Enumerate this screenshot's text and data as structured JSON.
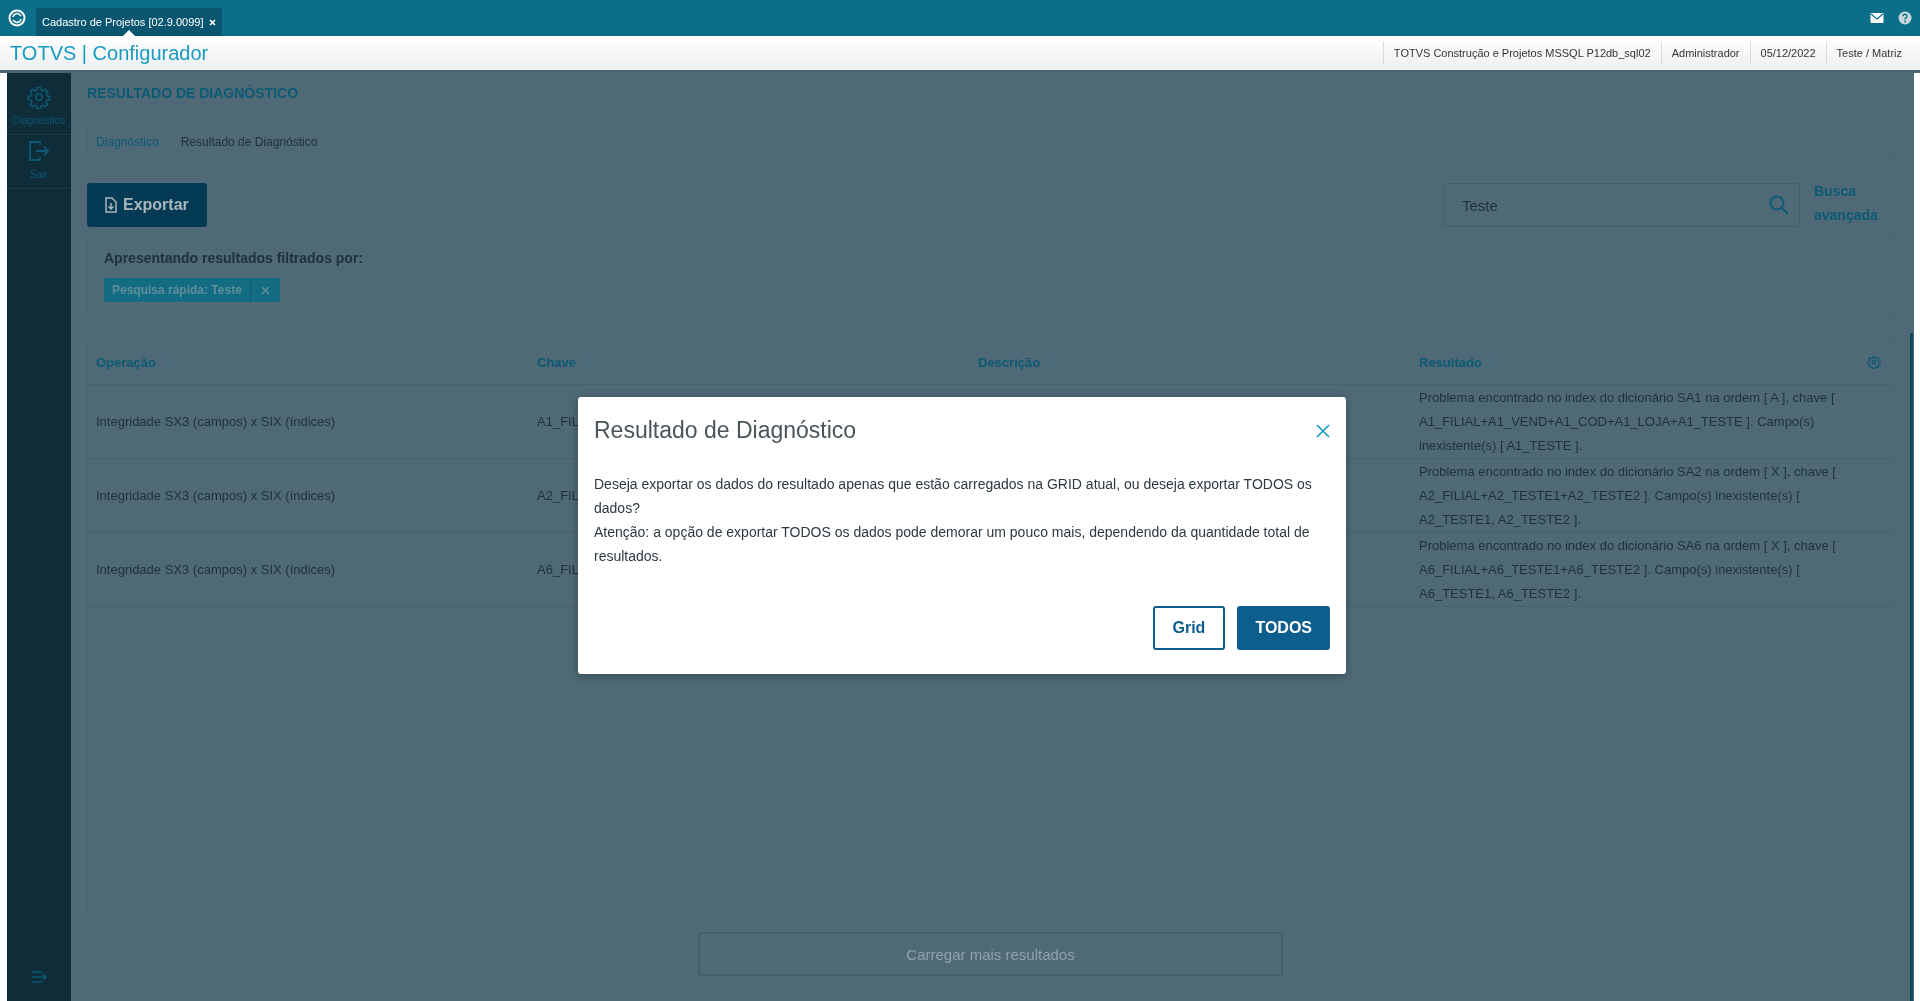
{
  "tab_bar": {
    "tabs": [
      {
        "label": "Cadastro de Projetos [02.9.0099]",
        "selected": true
      }
    ]
  },
  "header": {
    "title": "TOTVS | Configurador",
    "info": [
      "TOTVS Construção e Projetos MSSQL P12db_sql02",
      "Administrador",
      "05/12/2022",
      "Teste / Matriz"
    ]
  },
  "sidebar": {
    "items": [
      {
        "label": "Diagnóstico",
        "kind": "settings"
      },
      {
        "label": "Sair",
        "kind": "exit"
      }
    ]
  },
  "page": {
    "title": "RESULTADO DE DIAGNÓSTICO",
    "breadcrumb": [
      "Diagnóstico",
      "Resultado de Diagnóstico"
    ],
    "export_button": "Exportar",
    "search": {
      "value": "Teste"
    },
    "advanced_search": "Busca avançada",
    "filter": {
      "label": "Apresentando resultados filtrados por:",
      "tags": [
        "Pesquisa rápida: Teste"
      ]
    },
    "table": {
      "columns": [
        "Operação",
        "Chave",
        "Descrição",
        "Resultado"
      ],
      "rows": [
        {
          "operacao": "Integridade SX3 (campos) x SIX (índices)",
          "chave": "A1_FIL",
          "resultado": "Problema encontrado no index do dicionário SA1 na ordem [ A ], chave [ A1_FILIAL+A1_VEND+A1_COD+A1_LOJA+A1_TESTE ]. Campo(s) inexistente(s) [ A1_TESTE ]."
        },
        {
          "operacao": "Integridade SX3 (campos) x SIX (índices)",
          "chave": "A2_FIL",
          "resultado": "Problema encontrado no index do dicionário SA2 na ordem [ X ], chave [ A2_FILIAL+A2_TESTE1+A2_TESTE2 ]. Campo(s) inexistente(s) [ A2_TESTE1, A2_TESTE2 ]."
        },
        {
          "operacao": "Integridade SX3 (campos) x SIX (índices)",
          "chave": "A6_FIL",
          "resultado": "Problema encontrado no index do dicionário SA6 na ordem [ X ], chave [ A6_FILIAL+A6_TESTE1+A6_TESTE2 ]. Campo(s) inexistente(s) [ A6_TESTE1, A6_TESTE2 ]."
        }
      ]
    },
    "load_more": "Carregar mais resultados"
  },
  "dialog": {
    "title": "Resultado de Diagnóstico",
    "paragraphs": [
      "Deseja exportar os dados do resultado apenas que estão carregados na GRID atual, ou deseja exportar TODOS os dados?",
      "Atenção: a opção de exportar TODOS os dados pode demorar um pouco mais, dependendo da quantidade total de resultados."
    ],
    "buttons": [
      {
        "label": "Grid",
        "kind": "secondary"
      },
      {
        "label": "TODOS",
        "kind": "primary"
      }
    ]
  }
}
